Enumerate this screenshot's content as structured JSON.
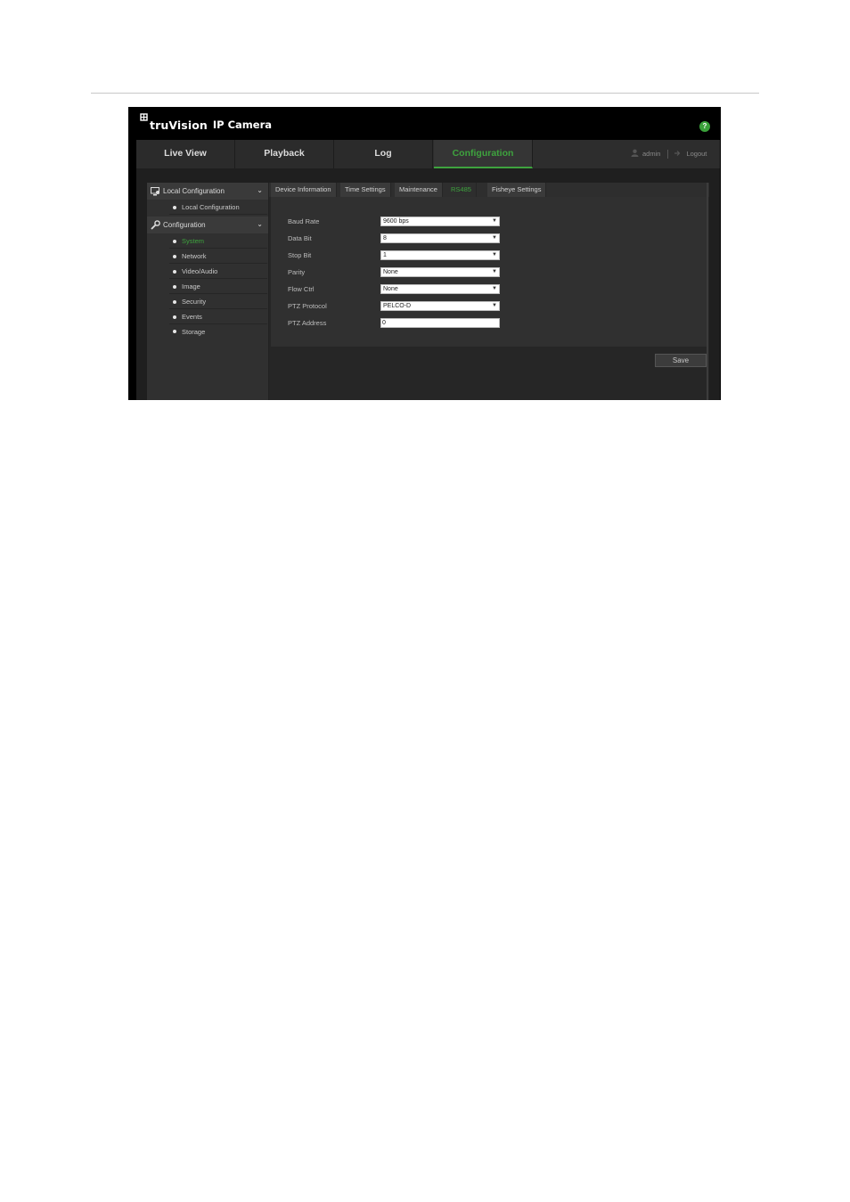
{
  "header": {
    "brand": "truVision",
    "product": "IP Camera",
    "help_label": "?"
  },
  "nav": {
    "tabs": [
      {
        "label": "Live View",
        "active": false
      },
      {
        "label": "Playback",
        "active": false
      },
      {
        "label": "Log",
        "active": false
      },
      {
        "label": "Configuration",
        "active": true
      }
    ],
    "user": "admin",
    "logout": "Logout"
  },
  "sidebar": {
    "local_section": "Local Configuration",
    "local_items": [
      "Local Configuration"
    ],
    "config_section": "Configuration",
    "config_items": [
      "System",
      "Network",
      "Video/Audio",
      "Image",
      "Security",
      "Events",
      "Storage"
    ],
    "active_item": "System"
  },
  "tabs": [
    "Device Information",
    "Time Settings",
    "Maintenance",
    "RS485",
    "Fisheye Settings"
  ],
  "active_tab": "RS485",
  "form": {
    "baud_rate": {
      "label": "Baud Rate",
      "value": "9600 bps"
    },
    "data_bit": {
      "label": "Data Bit",
      "value": "8"
    },
    "stop_bit": {
      "label": "Stop Bit",
      "value": "1"
    },
    "parity": {
      "label": "Parity",
      "value": "None"
    },
    "flow_ctrl": {
      "label": "Flow Ctrl",
      "value": "None"
    },
    "ptz_protocol": {
      "label": "PTZ Protocol",
      "value": "PELCO-D"
    },
    "ptz_address": {
      "label": "PTZ Address",
      "value": "0"
    }
  },
  "save_label": "Save",
  "colors": {
    "accent": "#3ea33e",
    "background": "#1f1f1f",
    "panel": "#303030"
  }
}
